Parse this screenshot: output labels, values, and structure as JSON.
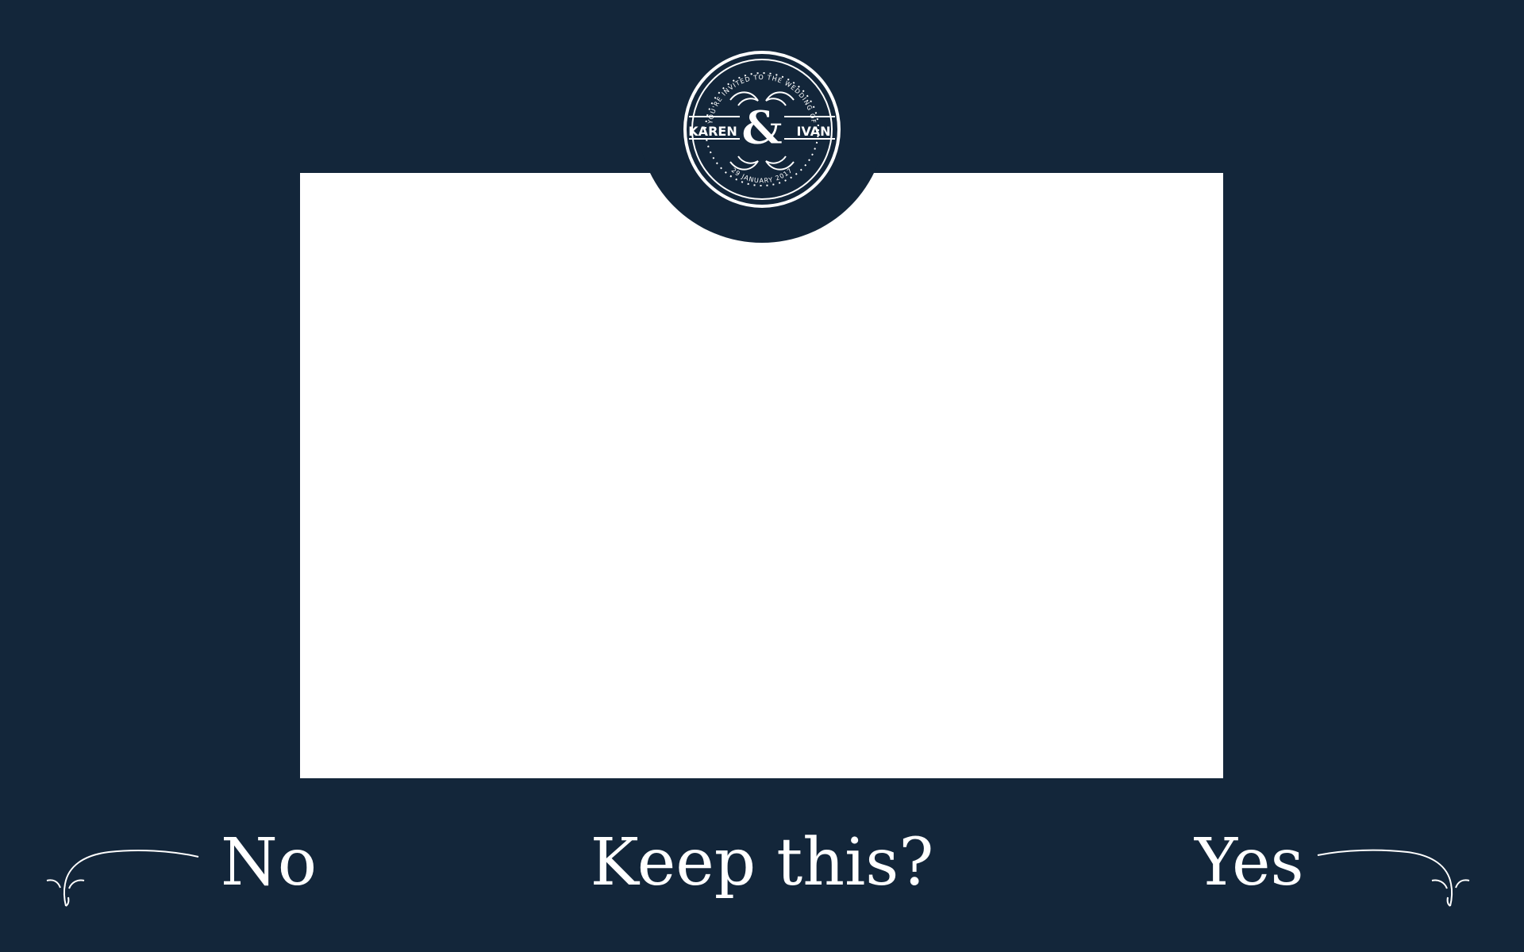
{
  "theme": {
    "background": "#13263a",
    "panel": "#ffffff",
    "text": "#ffffff"
  },
  "seal": {
    "top_arc": "YOU'RE INVITED TO THE WEDDING OF",
    "name_left": "KAREN",
    "ampersand": "&",
    "name_right": "IVAN",
    "bottom_arc": "29 JANUARY 2017"
  },
  "prompt": {
    "question": "Keep this?"
  },
  "choices": {
    "no_label": "No",
    "yes_label": "Yes"
  },
  "icons": {
    "seal": "wedding-seal-icon",
    "left_flourish": "left-flourish-icon",
    "right_flourish": "right-flourish-icon"
  }
}
